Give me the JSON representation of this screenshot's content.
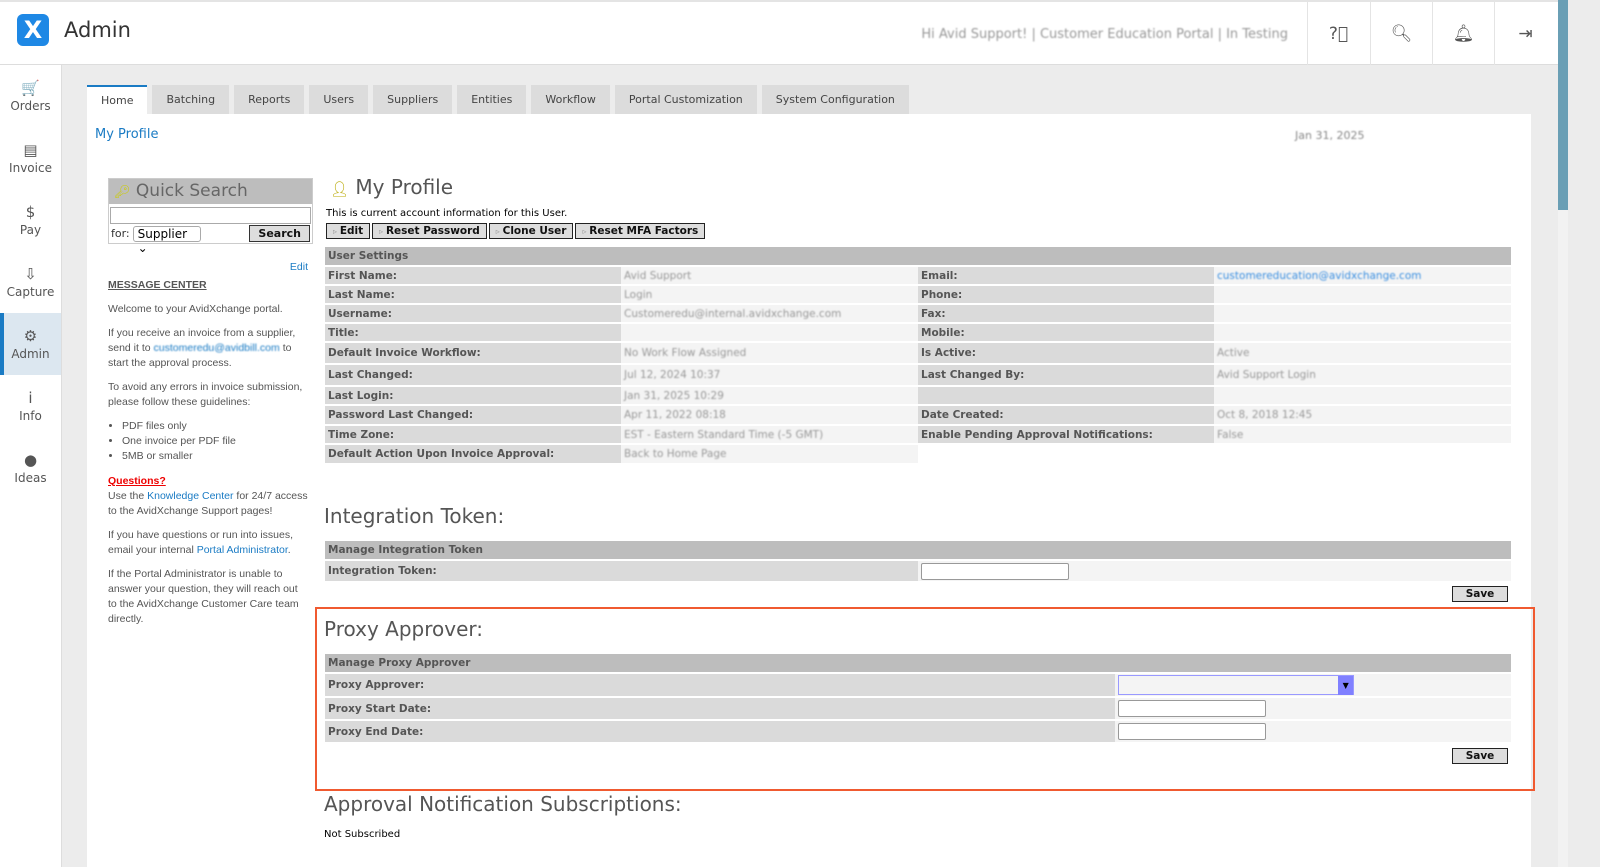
{
  "header": {
    "app_title": "Admin",
    "greeting": "Hi Avid Support! | Customer Education Portal | In Testing"
  },
  "sidebar": {
    "items": [
      {
        "label": "Orders",
        "icon": "🛒"
      },
      {
        "label": "Invoice",
        "icon": "▤"
      },
      {
        "label": "Pay",
        "icon": "$"
      },
      {
        "label": "Capture",
        "icon": "⇩"
      },
      {
        "label": "Admin",
        "icon": "⚙"
      },
      {
        "label": "Info",
        "icon": "i"
      },
      {
        "label": "Ideas",
        "icon": "●"
      }
    ]
  },
  "tabs": [
    "Home",
    "Batching",
    "Reports",
    "Users",
    "Suppliers",
    "Entities",
    "Workflow",
    "Portal Customization",
    "System Configuration"
  ],
  "breadcrumb": "My Profile",
  "date": "Jan 31, 2025",
  "quick_search": {
    "title": "Quick Search",
    "for_label": "for:",
    "selected": "Supplier",
    "button": "Search"
  },
  "message_center": {
    "edit": "Edit",
    "title": "MESSAGE CENTER",
    "welcome": "Welcome to your AvidXchange portal.",
    "p1a": "If you receive an invoice from a supplier, send it to",
    "p1_email": "customeredu@avidbill.com",
    "p1b": "to start the approval process.",
    "p2": "To avoid any errors in invoice submission, please follow these guidelines:",
    "bullets": [
      "PDF files only",
      "One invoice per PDF file",
      "5MB or smaller"
    ],
    "questions": "Questions?",
    "p3a": "Use the",
    "p3_link": "Knowledge Center",
    "p3b": "for 24/7 access to the AvidXchange Support pages!",
    "p4a": "If you have questions or run into issues, email your internal",
    "p4_link": "Portal Administrator",
    "p4b": ".",
    "p5": "If the Portal Administrator is unable to answer your question, they will reach out to the AvidXchange Customer Care team directly."
  },
  "profile": {
    "title": "My Profile",
    "subtitle": "This is current account information for this User.",
    "buttons": [
      "Edit",
      "Reset Password",
      "Clone User",
      "Reset MFA Factors"
    ],
    "section": "User Settings",
    "rows": [
      {
        "l1": "First Name:",
        "v1": "Avid Support",
        "l2": "Email:",
        "v2": "customereducation@avidxchange.com"
      },
      {
        "l1": "Last Name:",
        "v1": "Login",
        "l2": "Phone:",
        "v2": ""
      },
      {
        "l1": "Username:",
        "v1": "Customeredu@internal.avidxchange.com",
        "l2": "Fax:",
        "v2": ""
      },
      {
        "l1": "Title:",
        "v1": "",
        "l2": "Mobile:",
        "v2": ""
      },
      {
        "l1": "Default Invoice Workflow:",
        "v1": "No Work Flow Assigned",
        "l2": "Is Active:",
        "v2": "Active"
      },
      {
        "l1": "Last Changed:",
        "v1": "Jul 12, 2024 10:37",
        "l2": "Last Changed By:",
        "v2": "Avid Support Login"
      },
      {
        "l1": "Last Login:",
        "v1": "Jan 31, 2025 10:29",
        "l2": "",
        "v2": ""
      },
      {
        "l1": "Password Last Changed:",
        "v1": "Apr 11, 2022 08:18",
        "l2": "Date Created:",
        "v2": "Oct 8, 2018 12:45"
      },
      {
        "l1": "Time Zone:",
        "v1": "EST - Eastern Standard Time (-5 GMT)",
        "l2": "Enable Pending Approval Notifications:",
        "v2": "False"
      },
      {
        "l1": "Default Action Upon Invoice Approval:",
        "v1": "Back to Home Page",
        "l2": "",
        "v2": ""
      }
    ]
  },
  "integration": {
    "title": "Integration Token:",
    "section": "Manage Integration Token",
    "label": "Integration Token:",
    "value": "",
    "save": "Save"
  },
  "proxy": {
    "title": "Proxy Approver:",
    "section": "Manage Proxy Approver",
    "approver_label": "Proxy Approver:",
    "start_label": "Proxy Start Date:",
    "end_label": "Proxy End Date:",
    "save": "Save"
  },
  "notifications": {
    "title": "Approval Notification Subscriptions:",
    "status": "Not Subscribed"
  }
}
